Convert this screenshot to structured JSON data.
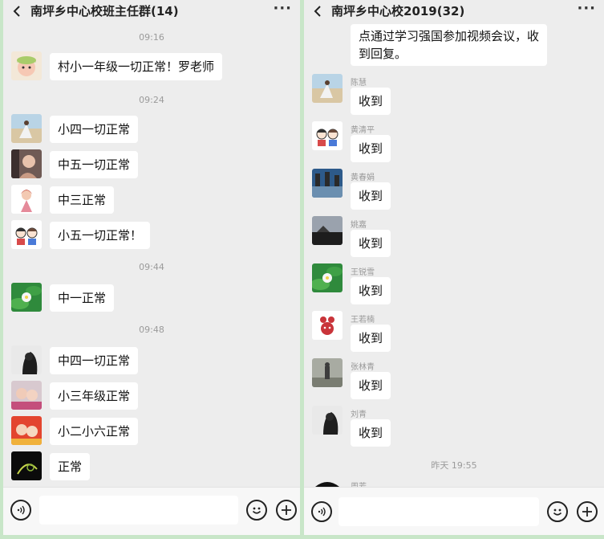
{
  "colors": {
    "window_bg": "#ededed",
    "bubble_bg": "#ffffff",
    "frame_bg": "#c8e6c8"
  },
  "left_chat": {
    "title": "南坪乡中心校班主任群(14)",
    "more_label": "···",
    "timestamps": [
      "09:16",
      "09:24",
      "09:44",
      "09:48"
    ],
    "messages": [
      {
        "text": "村小一年级一切正常！罗老师",
        "avatar": "cartoon-avatar"
      },
      {
        "text": "小四一切正常",
        "avatar": "beach-avatar"
      },
      {
        "text": "中五一切正常",
        "avatar": "portrait-avatar"
      },
      {
        "text": "中三正常",
        "avatar": "girl-avatar"
      },
      {
        "text": "小五一切正常！",
        "avatar": "couple-avatar"
      },
      {
        "text": "中一正常",
        "avatar": "lotus-avatar"
      },
      {
        "text": "中四一切正常",
        "avatar": "dark-avatar"
      },
      {
        "text": "小三年级正常",
        "avatar": "pink-avatar"
      },
      {
        "text": "小二小六正常",
        "avatar": "red-avatar"
      },
      {
        "text": "正常",
        "avatar": "night-avatar"
      }
    ]
  },
  "right_chat": {
    "title": "南坪乡中心校2019(32)",
    "more_label": "···",
    "top_message": [
      "点通过学习强国参加视频会议，收",
      "到回复。"
    ],
    "messages": [
      {
        "sender": "陈慧",
        "text": "收到"
      },
      {
        "sender": "黄清平",
        "text": "收到"
      },
      {
        "sender": "黄春娟",
        "text": "收到"
      },
      {
        "sender": "姚嘉",
        "text": "收到"
      },
      {
        "sender": "王锐雪",
        "text": "收到"
      },
      {
        "sender": "王若楠",
        "text": "收到"
      },
      {
        "sender": "张林青",
        "text": "收到"
      },
      {
        "sender": "刘青",
        "text": "收到"
      }
    ],
    "timestamp": "昨天 19:55",
    "partial_sender": "周芳"
  },
  "input_bar": {
    "voice_icon": "voice-icon",
    "emoji_icon": "emoji-icon",
    "plus_icon": "plus-icon"
  }
}
